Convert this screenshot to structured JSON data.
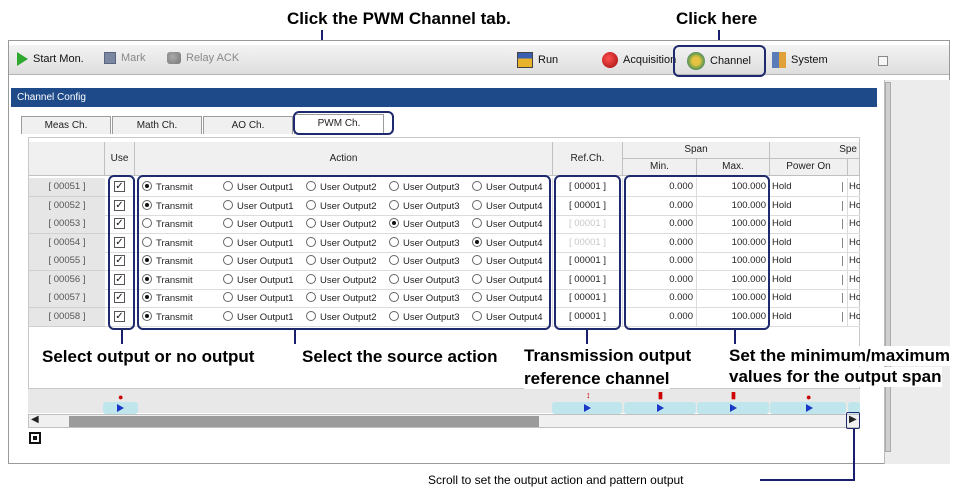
{
  "annotations": {
    "pwm_tab": "Click the PWM Channel tab.",
    "click_here": "Click here",
    "select_output": "Select output or no output",
    "select_action": "Select the source action",
    "transmission_ref_1": "Transmission output",
    "transmission_ref_2": "reference channel",
    "set_span_1": "Set the minimum/maximum",
    "set_span_2": "values for the output span",
    "scroll": "Scroll to set the output action and pattern output"
  },
  "toolbar": {
    "start_mon": "Start Mon.",
    "mark": "Mark",
    "relay_ack": "Relay ACK"
  },
  "nav": {
    "run": "Run",
    "acquisition": "Acquisition",
    "channel": "Channel",
    "system": "System"
  },
  "panel": {
    "title": "Channel Config"
  },
  "tabs": [
    "Meas Ch.",
    "Math Ch.",
    "AO Ch.",
    "PWM Ch."
  ],
  "columns": {
    "use": "Use",
    "action": "Action",
    "ref_ch": "Ref.Ch.",
    "span": "Span",
    "min": "Min.",
    "max": "Max.",
    "power_on": "Power On",
    "spe": "Spe",
    "hold_trunc": "Ho"
  },
  "action_options": [
    "Transmit",
    "User Output1",
    "User Output2",
    "User Output3",
    "User Output4"
  ],
  "rows": [
    {
      "id": "[ 00051 ]",
      "use": true,
      "action": 0,
      "ref": "[ 00001 ]",
      "ref_enabled": true,
      "min": "0.000",
      "max": "100.000",
      "power_on": "Hold"
    },
    {
      "id": "[ 00052 ]",
      "use": true,
      "action": 0,
      "ref": "[ 00001 ]",
      "ref_enabled": true,
      "min": "0.000",
      "max": "100.000",
      "power_on": "Hold"
    },
    {
      "id": "[ 00053 ]",
      "use": true,
      "action": 3,
      "ref": "[ 00001 ]",
      "ref_enabled": false,
      "min": "0.000",
      "max": "100.000",
      "power_on": "Hold"
    },
    {
      "id": "[ 00054 ]",
      "use": true,
      "action": 4,
      "ref": "[ 00001 ]",
      "ref_enabled": false,
      "min": "0.000",
      "max": "100.000",
      "power_on": "Hold"
    },
    {
      "id": "[ 00055 ]",
      "use": true,
      "action": 0,
      "ref": "[ 00001 ]",
      "ref_enabled": true,
      "min": "0.000",
      "max": "100.000",
      "power_on": "Hold"
    },
    {
      "id": "[ 00056 ]",
      "use": true,
      "action": 0,
      "ref": "[ 00001 ]",
      "ref_enabled": true,
      "min": "0.000",
      "max": "100.000",
      "power_on": "Hold"
    },
    {
      "id": "[ 00057 ]",
      "use": true,
      "action": 0,
      "ref": "[ 00001 ]",
      "ref_enabled": true,
      "min": "0.000",
      "max": "100.000",
      "power_on": "Hold"
    },
    {
      "id": "[ 00058 ]",
      "use": true,
      "action": 0,
      "ref": "[ 00001 ]",
      "ref_enabled": true,
      "min": "0.000",
      "max": "100.000",
      "power_on": "Hold"
    }
  ],
  "colors": {
    "highlight": "#1f2a6e",
    "title_bar": "#1e4a8a",
    "pattern": "#bfe6ec",
    "flag": "#1b37c8"
  },
  "icons": [
    "play-icon",
    "mark-icon",
    "relay-icon",
    "run-icon",
    "acquisition-icon",
    "channel-icon",
    "system-icon",
    "minimize-icon",
    "flag-icon"
  ]
}
